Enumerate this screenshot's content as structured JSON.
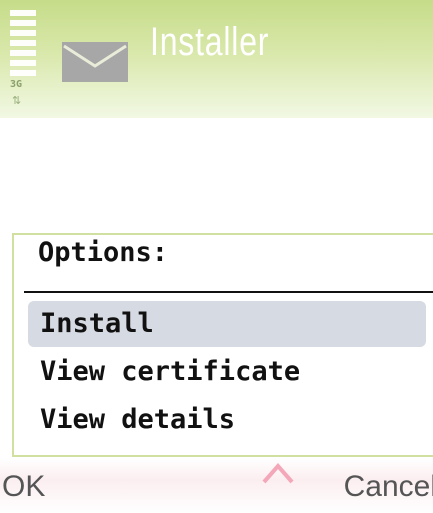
{
  "status": {
    "network": "3G",
    "signal_level": 1.0
  },
  "app": {
    "title": "Installer",
    "icon": "envelope-icon"
  },
  "options_popup": {
    "title": "Options:",
    "items": [
      {
        "label": "Install",
        "selected": true
      },
      {
        "label": "View certificate",
        "selected": false
      },
      {
        "label": "View details",
        "selected": false
      }
    ]
  },
  "softkeys": {
    "left": "OK",
    "right": "Cancel"
  },
  "colors": {
    "status_bg": "#c6dc89",
    "selection": "#d6dae2",
    "softkey_tint": "#fbeef0"
  }
}
